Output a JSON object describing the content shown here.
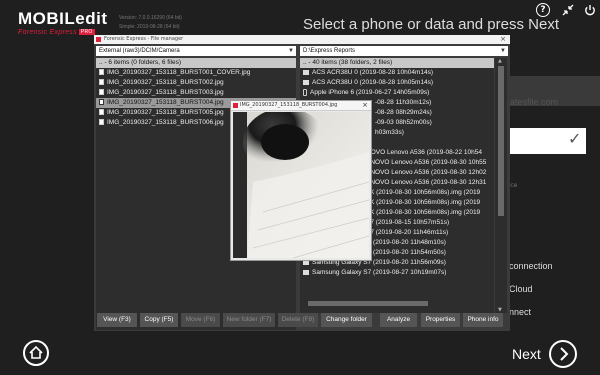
{
  "app": {
    "brand": "MOBILedit",
    "subtitle": "Forensic Express",
    "pro_badge": "PRO",
    "version_line1": "Version: 7.0.0.16290 (64 bit)",
    "version_line2": "Simple: 2019-08-28 (64 bit)",
    "headline": "Select a phone or data and press Next"
  },
  "background": {
    "url_text": "piratesfile.com",
    "device_label": "vice",
    "options": [
      "connection",
      "Cloud",
      "nnect"
    ]
  },
  "file_manager": {
    "title": "Forensic Express - File manager",
    "left_path": "External (raw3)/DCIM/Camera",
    "right_path": "D:\\Express Reports",
    "left_header": ".. - 6 items (0 folders, 6 files)",
    "right_header": ".. - 40 items (38 folders, 2 files)",
    "left_files": [
      "IMG_20190327_153118_BURST001_COVER.jpg",
      "IMG_20190327_153118_BURST002.jpg",
      "IMG_20190327_153118_BURST003.jpg",
      "IMG_20190327_153118_BURST004.jpg",
      "IMG_20190327_153118_BURST005.jpg",
      "IMG_20190327_153118_BURST006.jpg"
    ],
    "selected_index": 3,
    "right_items": [
      "ACS ACR38U 0 (2019-08-28 10h04m14s)",
      "ACS ACR38U 0 (2019-08-28 10h05m14s)",
      "Apple iPhone 6 (2019-06-27 14h05m09s)",
      "-08-28 11h30m12s)",
      "-08-28 08h29m24s)",
      "-09-03 08h52m00s)",
      "h03m33s)",
      "",
      "NOVO Lenovo A536 (2019-08-22 10h54",
      "ENOVO Lenovo A536 (2019-08-30 10h55",
      "ENOVO Lenovo A536 (2019-08-30 12h02",
      "ENOVO Lenovo A536 (2019-08-30 12h31",
      "TK (2019-08-30 10h56m08s).img (2019",
      "TK (2019-08-30 10h56m08s).img (2019",
      "TK (2019-08-30 10h56m08s).img (2019",
      "S7 (2019-08-15 10h57m51s)",
      "S7 (2019-08-20 11h46m11s)",
      "Samsung Galaxy S7 (2019-08-20 11h48m10s)",
      "Samsung Galaxy S7 (2019-08-20 11h54m50s)",
      "Samsung Galaxy S7 (2019-08-20 11h56m09s)",
      "Samsung Galaxy S7 (2019-08-27 10h19m07s)"
    ],
    "buttons": {
      "view": "View (F3)",
      "copy": "Copy (F5)",
      "move": "Move (F6)",
      "new_folder": "New folder (F7)",
      "delete": "Delete (F8)",
      "change_folder": "Change folder",
      "analyze": "Analyze",
      "properties": "Properties",
      "phone_info": "Phone info"
    }
  },
  "preview": {
    "title": "IMG_20190327_153118_BURST004.jpg"
  },
  "nav": {
    "next_label": "Next"
  },
  "colors": {
    "accent": "#e21f3f",
    "background": "#1f1f1f",
    "panel": "#3b3b3b"
  }
}
